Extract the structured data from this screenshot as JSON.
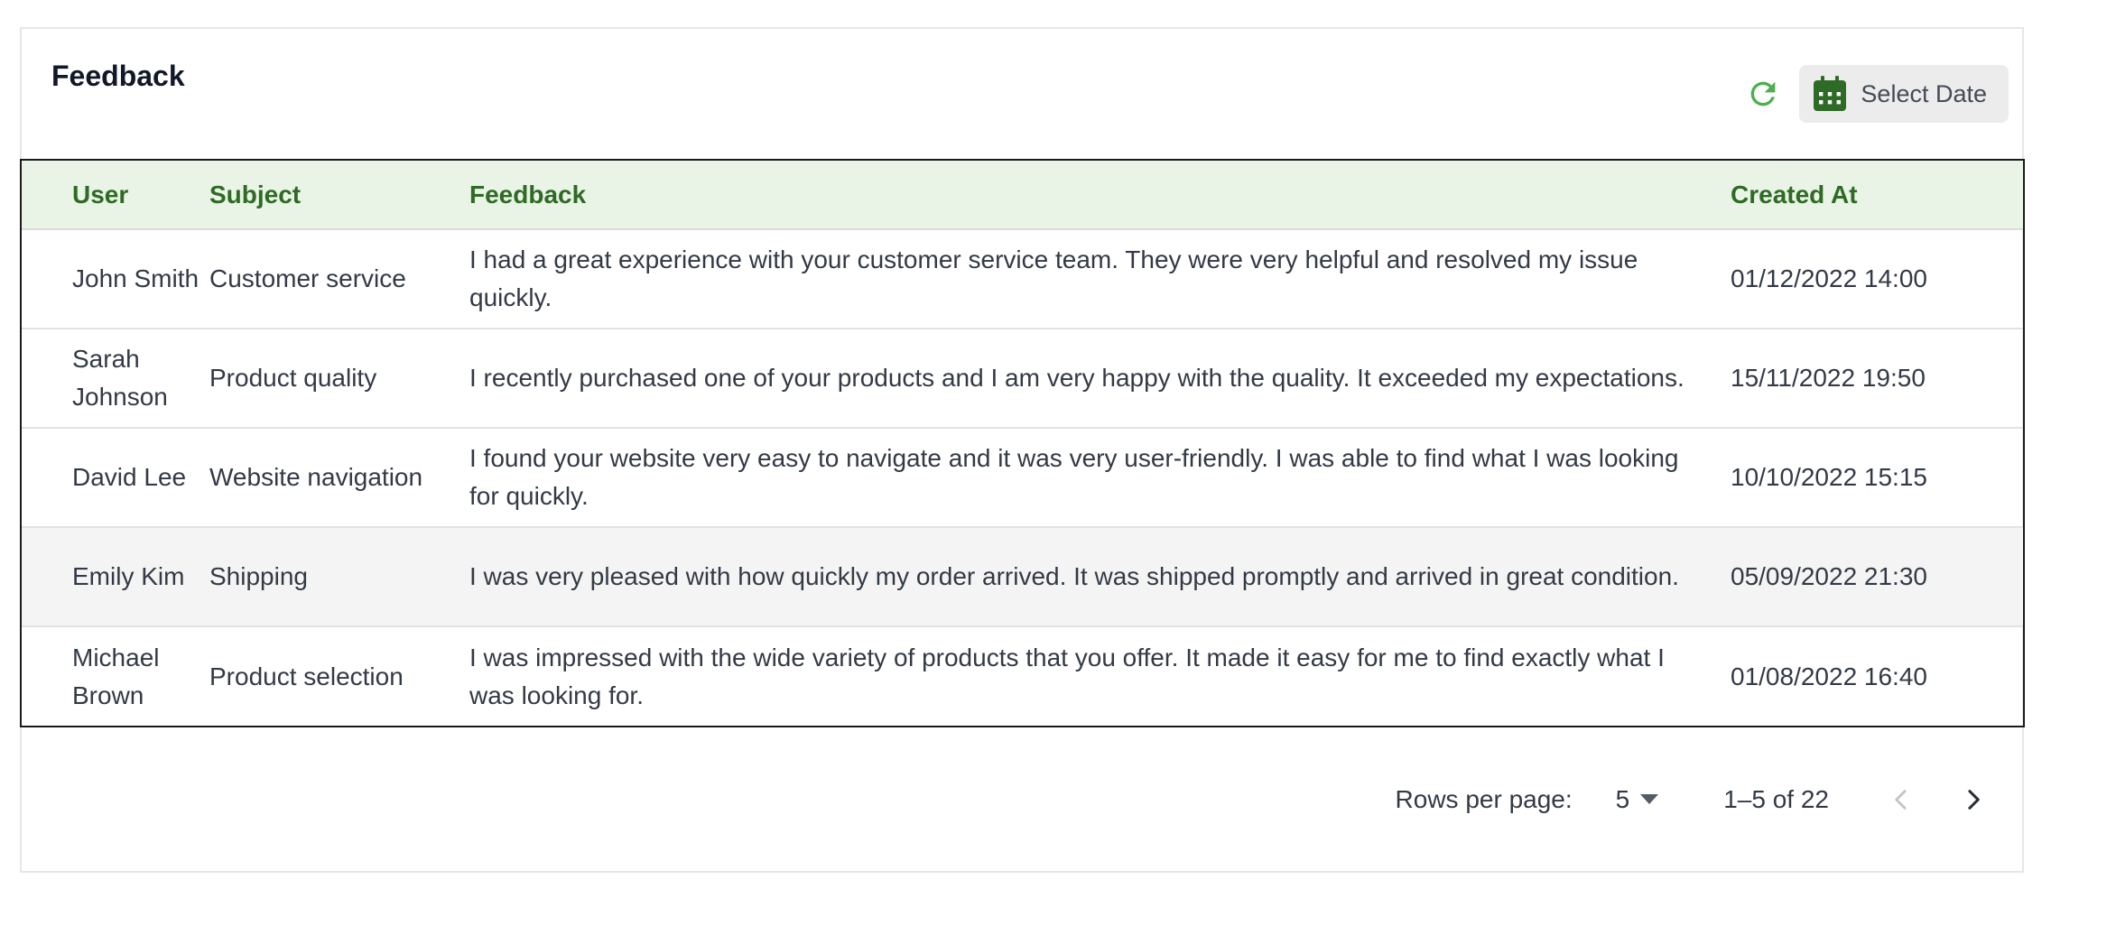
{
  "page": {
    "title": "Feedback"
  },
  "toolbar": {
    "refresh_icon": "refresh-icon",
    "date_icon": "calendar-icon",
    "date_label": "Select Date"
  },
  "table": {
    "columns": [
      "User",
      "Subject",
      "Feedback",
      "Created At"
    ],
    "rows": [
      {
        "user": "John Smith",
        "subject": "Customer service",
        "feedback": "I had a great experience with your customer service team. They were very helpful and resolved my issue quickly.",
        "created_at": "01/12/2022 14:00",
        "highlighted": false
      },
      {
        "user": "Sarah Johnson",
        "subject": "Product quality",
        "feedback": "I recently purchased one of your products and I am very happy with the quality. It exceeded my expectations.",
        "created_at": "15/11/2022 19:50",
        "highlighted": false
      },
      {
        "user": "David Lee",
        "subject": "Website navigation",
        "feedback": "I found your website very easy to navigate and it was very user-friendly. I was able to find what I was looking for quickly.",
        "created_at": "10/10/2022 15:15",
        "highlighted": false
      },
      {
        "user": "Emily Kim",
        "subject": "Shipping",
        "feedback": "I was very pleased with how quickly my order arrived. It was shipped promptly and arrived in great condition.",
        "created_at": "05/09/2022 21:30",
        "highlighted": true
      },
      {
        "user": "Michael Brown",
        "subject": "Product selection",
        "feedback": "I was impressed with the wide variety of products that you offer. It made it easy for me to find exactly what I was looking for.",
        "created_at": "01/08/2022 16:40",
        "highlighted": false
      }
    ]
  },
  "pagination": {
    "rows_per_page_label": "Rows per page:",
    "rows_per_page_value": "5",
    "range_text": "1–5 of 22",
    "prev_icon": "chevron-left-icon",
    "next_icon": "chevron-right-icon"
  },
  "colors": {
    "accent_green": "#2f6b24",
    "header_bg": "#e9f4e7",
    "refresh_green": "#4caf50"
  }
}
